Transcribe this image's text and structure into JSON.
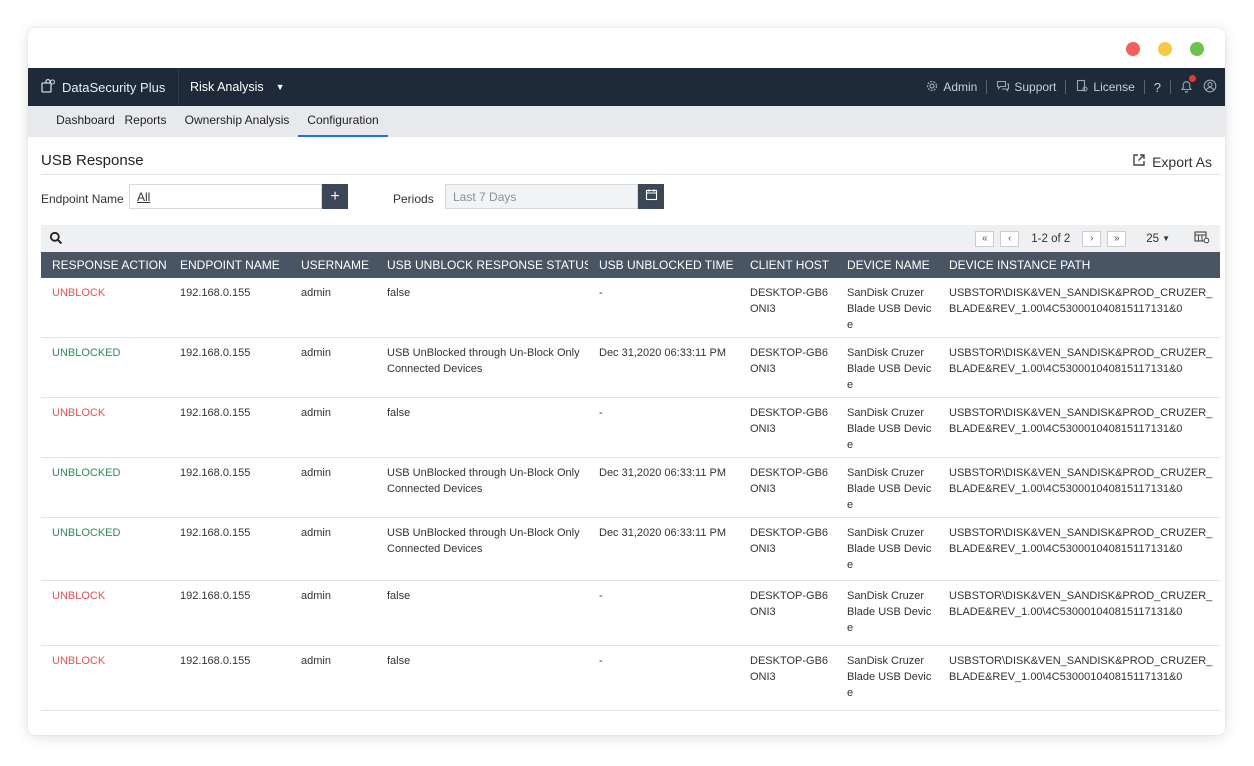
{
  "window": {
    "controls": [
      "close",
      "minimize",
      "maximize"
    ]
  },
  "appbar": {
    "brand_name": "DataSecurity Plus",
    "module": "Risk Analysis",
    "links": {
      "admin": "Admin",
      "support": "Support",
      "license": "License",
      "help": "?"
    }
  },
  "tabs": [
    {
      "label": "Dashboard"
    },
    {
      "label": "Reports"
    },
    {
      "label": "Ownership Analysis"
    },
    {
      "label": "Configuration",
      "active": true
    }
  ],
  "page": {
    "title": "USB Response",
    "export_label": "Export As"
  },
  "filters": {
    "endpoint_label": "Endpoint Name",
    "endpoint_value": "All",
    "periods_label": "Periods",
    "periods_placeholder": "Last 7 Days"
  },
  "pager": {
    "range_text": "1-2 of 2",
    "page_size": "25"
  },
  "table": {
    "headers": [
      "RESPONSE ACTION",
      "ENDPOINT NAME",
      "USERNAME",
      "USB UNBLOCK RESPONSE STATUS",
      "USB UNBLOCKED TIME",
      "CLIENT HOST",
      "DEVICE NAME",
      "DEVICE INSTANCE PATH"
    ],
    "rows": [
      {
        "action": "UNBLOCK",
        "endpoint": "192.168.0.155",
        "username": "admin",
        "status": "false",
        "time": "-",
        "host": "DESKTOP-GB6ONI3",
        "device": "SanDisk Cruzer Blade USB Device",
        "path": "USBSTOR\\DISK&VEN_SANDISK&PROD_CRUZER_BLADE&REV_1.00\\4C530001040815117131&0"
      },
      {
        "action": "UNBLOCKED",
        "endpoint": "192.168.0.155",
        "username": "admin",
        "status": "USB UnBlocked through Un-Block Only Connected Devices",
        "time": "Dec 31,2020 06:33:11 PM",
        "host": "DESKTOP-GB6ONI3",
        "device": "SanDisk Cruzer Blade USB Device",
        "path": "USBSTOR\\DISK&VEN_SANDISK&PROD_CRUZER_BLADE&REV_1.00\\4C530001040815117131&0"
      },
      {
        "action": "UNBLOCK",
        "endpoint": "192.168.0.155",
        "username": "admin",
        "status": "false",
        "time": "-",
        "host": "DESKTOP-GB6ONI3",
        "device": "SanDisk Cruzer Blade USB Device",
        "path": "USBSTOR\\DISK&VEN_SANDISK&PROD_CRUZER_BLADE&REV_1.00\\4C530001040815117131&0"
      },
      {
        "action": "UNBLOCKED",
        "endpoint": "192.168.0.155",
        "username": "admin",
        "status": "USB UnBlocked through Un-Block Only Connected Devices",
        "time": "Dec 31,2020 06:33:11 PM",
        "host": "DESKTOP-GB6ONI3",
        "device": "SanDisk Cruzer Blade USB Device",
        "path": "USBSTOR\\DISK&VEN_SANDISK&PROD_CRUZER_BLADE&REV_1.00\\4C530001040815117131&0"
      },
      {
        "action": "UNBLOCKED",
        "endpoint": "192.168.0.155",
        "username": "admin",
        "status": "USB UnBlocked through Un-Block Only Connected Devices",
        "time": "Dec 31,2020 06:33:11 PM",
        "host": "DESKTOP-GB6ONI3",
        "device": "SanDisk Cruzer Blade USB Device",
        "path": "USBSTOR\\DISK&VEN_SANDISK&PROD_CRUZER_BLADE&REV_1.00\\4C530001040815117131&0"
      },
      {
        "action": "UNBLOCK",
        "endpoint": "192.168.0.155",
        "username": "admin",
        "status": "false",
        "time": "-",
        "host": "DESKTOP-GB6ONI3",
        "device": "SanDisk Cruzer Blade USB Device",
        "path": "USBSTOR\\DISK&VEN_SANDISK&PROD_CRUZER_BLADE&REV_1.00\\4C530001040815117131&0"
      },
      {
        "action": "UNBLOCK",
        "endpoint": "192.168.0.155",
        "username": "admin",
        "status": "false",
        "time": "-",
        "host": "DESKTOP-GB6ONI3",
        "device": "SanDisk Cruzer Blade USB Device",
        "path": "USBSTOR\\DISK&VEN_SANDISK&PROD_CRUZER_BLADE&REV_1.00\\4C530001040815117131&0"
      }
    ]
  },
  "colors": {
    "appbar_bg": "#1e2a38",
    "header_bg": "#4a5563",
    "unblock": "#e05454",
    "unblocked": "#2e8b57",
    "active_tab": "#1a73e8"
  }
}
